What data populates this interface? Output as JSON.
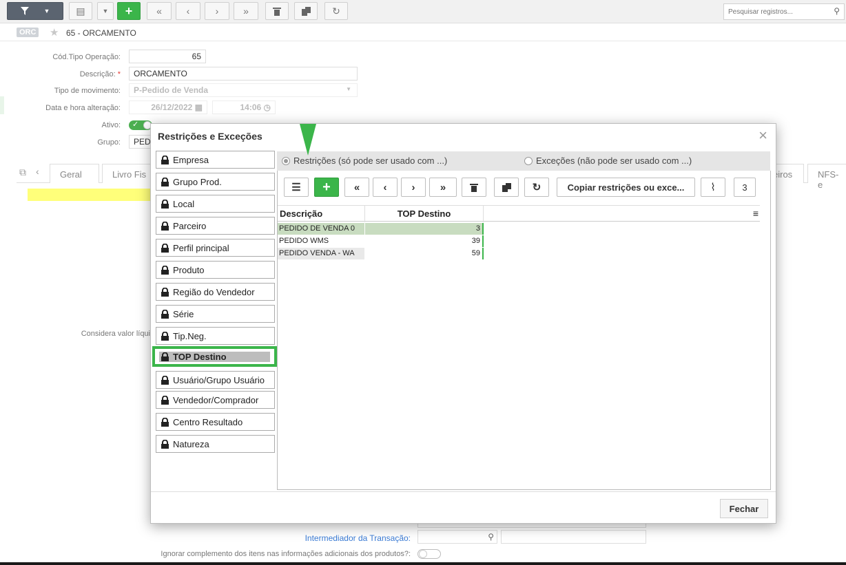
{
  "toolbar": {
    "search_placeholder": "Pesquisar registros..."
  },
  "breadcrumb": {
    "badge": "ORC",
    "title": "65 - ORCAMENTO"
  },
  "form": {
    "cod_tipo_label": "Cód.Tipo Operação:",
    "cod_tipo_value": "65",
    "descricao_label": "Descrição:",
    "descricao_value": "ORCAMENTO",
    "tipo_mov_label": "Tipo de movimento:",
    "tipo_mov_value": "P-Pedido de Venda",
    "data_label": "Data e hora alteração:",
    "data_value": "26/12/2022",
    "hora_value": "14:06",
    "ativo_label": "Ativo:",
    "grupo_label": "Grupo:",
    "grupo_value": "PED",
    "considera_label": "Considera valor líqui",
    "intermediador_label": "Intermediador da Transação:",
    "ignorar_label": "Ignorar complemento dos itens nas informações adicionais dos produtos?:"
  },
  "tabs": [
    "Geral",
    "Livro Fis",
    "eiros",
    "NFS-e"
  ],
  "modal": {
    "title": "Restrições e Exceções",
    "radio_restricoes": "Restrições (só pode ser usado com ...)",
    "radio_excecoes": "Exceções (não pode ser usado com ...)",
    "copy_button": "Copiar restrições ou exce...",
    "count": "3",
    "close_button": "Fechar",
    "side_items": [
      "Empresa",
      "Grupo Prod.",
      "Local",
      "Parceiro",
      "Perfil principal",
      "Produto",
      "Região do Vendedor",
      "Série",
      "Tip.Neg.",
      "TOP Destino",
      "Usuário/Grupo Usuário",
      "Vendedor/Comprador",
      "Centro Resultado",
      "Natureza"
    ],
    "grid": {
      "columns": [
        "Descrição",
        "TOP Destino"
      ],
      "rows": [
        [
          "PEDIDO DE VENDA 0",
          "3"
        ],
        [
          "PEDIDO WMS",
          "39"
        ],
        [
          "PEDIDO VENDA - WA",
          "59"
        ]
      ]
    }
  },
  "colors": {
    "accent_green": "#3bb54a",
    "toolbar_dark": "#5b6470",
    "highlight_yellow": "#ffff7a"
  }
}
